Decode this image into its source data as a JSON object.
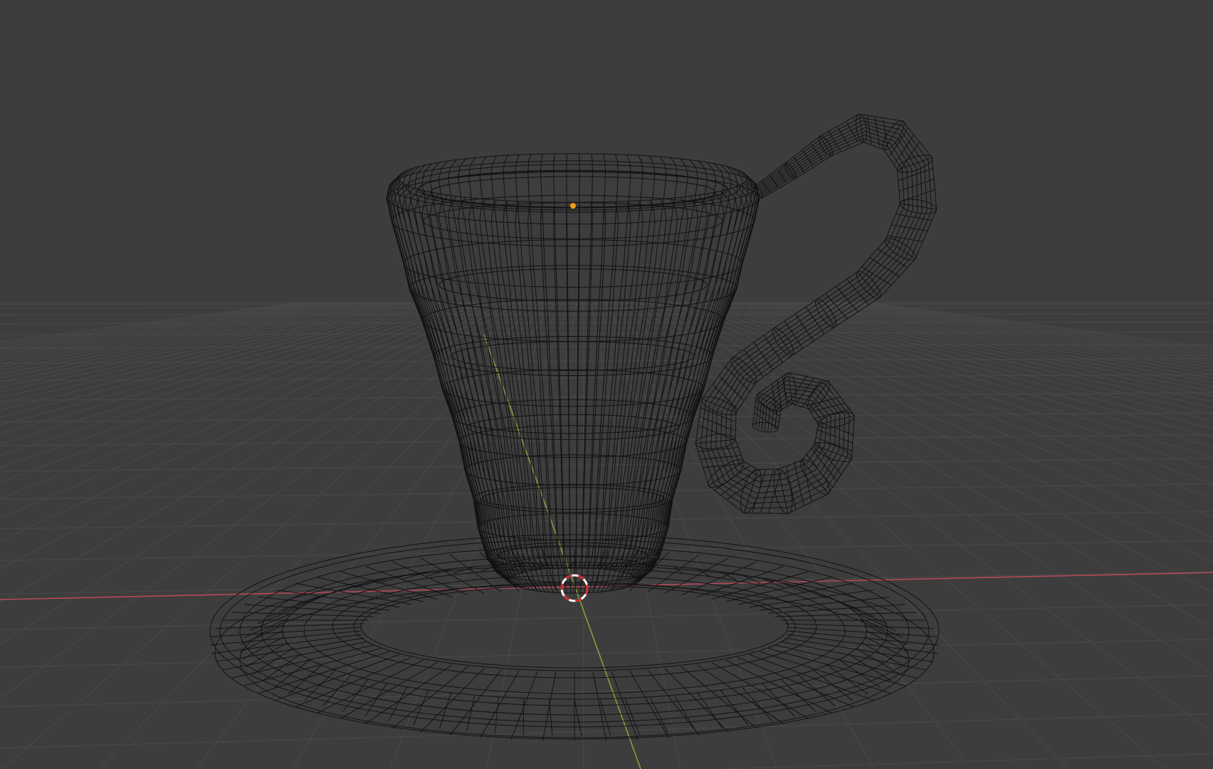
{
  "viewport": {
    "mode": "wireframe",
    "background_color": "#3d3d3d",
    "grid_color": "#4a4a4a",
    "axis_x_color": "#b54a5a",
    "axis_y_color": "#7ea33a",
    "wire_color": "#121212",
    "origin_color": "#f29a1c",
    "cursor_colors": [
      "#ffffff",
      "#cc2a2a"
    ],
    "objects": [
      "teacup",
      "teacup-handle",
      "saucer"
    ],
    "icons": [
      "3d-cursor-icon",
      "object-origin-icon"
    ]
  }
}
